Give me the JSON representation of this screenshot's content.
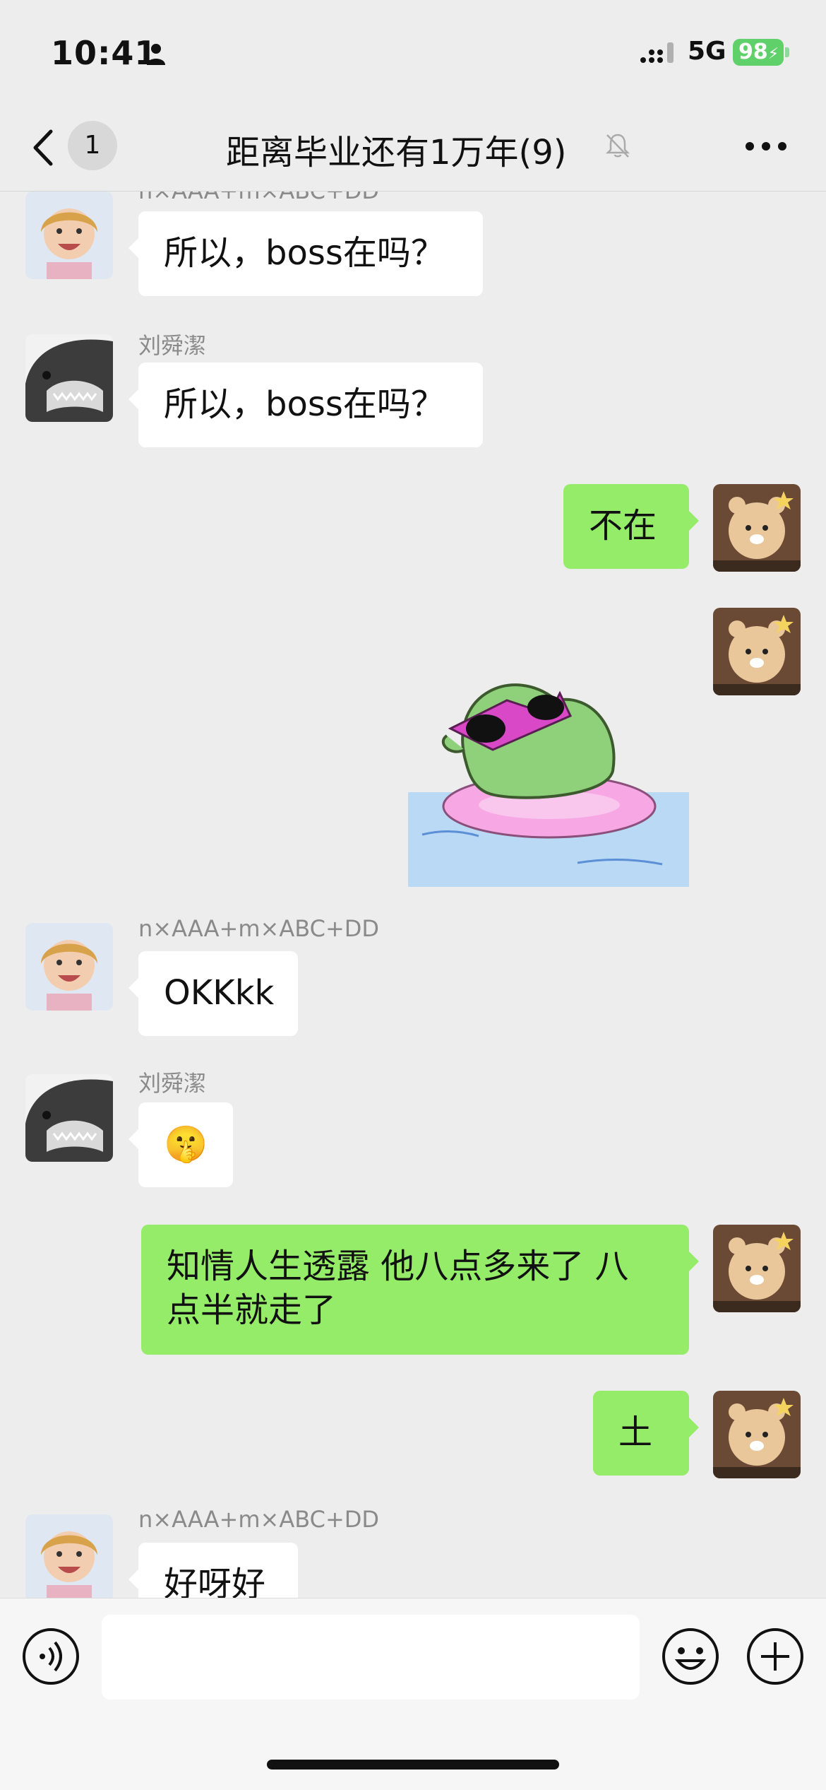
{
  "status_bar": {
    "time": "10:41",
    "network": "5G",
    "battery": "98"
  },
  "header": {
    "unread_count": "1",
    "title": "距离毕业还有1万年(9)"
  },
  "messages": [
    {
      "sender": "n×AAA+m×ABC+DD",
      "text": "所以，boss在吗？"
    },
    {
      "sender": "刘舜潔",
      "text": "所以，boss在吗？"
    },
    {
      "text": "不在"
    },
    {
      "sticker": "frog-sunglasses-sticker"
    },
    {
      "sender": "n×AAA+m×ABC+DD",
      "text": "OKKkk"
    },
    {
      "sender": "刘舜潔",
      "emoji": "🤫"
    },
    {
      "text_line1": "知情人生透露 他八点多来了 八",
      "text_line2": "点半就走了"
    },
    {
      "text": "土"
    },
    {
      "sender": "n×AAA+m×ABC+DD",
      "text": "好呀好"
    }
  ],
  "input": {
    "placeholder": ""
  },
  "colors": {
    "background": "#ededed",
    "incoming_bubble": "#ffffff",
    "outgoing_bubble": "#95ec69",
    "battery": "#5fd06a"
  }
}
